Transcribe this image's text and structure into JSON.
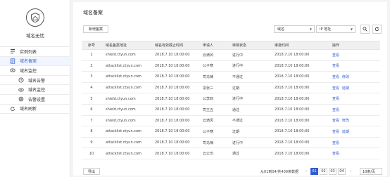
{
  "brand": {
    "name": "域名无忧"
  },
  "sidebar": {
    "items": [
      {
        "label": "实例列表"
      },
      {
        "label": "域名备案"
      },
      {
        "label": "域名监控"
      },
      {
        "label": "域名告警"
      },
      {
        "label": "域名监控"
      },
      {
        "label": "告警设置"
      },
      {
        "label": "域名刷新"
      }
    ]
  },
  "page": {
    "title": "域名备案"
  },
  "toolbar": {
    "add_label": "新增备案",
    "field_select": "域名",
    "ip_select": "IP 地址"
  },
  "table": {
    "headers": [
      "序号",
      "域名备案地址",
      "域名有效截止时间",
      "申请人",
      "审核状态",
      "审批时间",
      "操作"
    ],
    "rows": [
      {
        "no": "1",
        "domain": "shield.ctyun.com",
        "expire": "2018.7.10 18:00:00",
        "applicant": "云滴风",
        "status": "进行中",
        "approved": "2018.7.10 18:00:00",
        "ops": [
          "查看"
        ]
      },
      {
        "no": "2",
        "domain": "attacklist.ctyun.com",
        "expire": "2018.7.10 18:00:00",
        "applicant": "公子寒",
        "status": "进行中",
        "approved": "2018.7.10 18:00:00",
        "ops": [
          "查看"
        ]
      },
      {
        "no": "3",
        "domain": "attacklist.ctyun.com",
        "expire": "2018.7.10 18:00:00",
        "applicant": "司马楠",
        "status": "不通过",
        "approved": "2018.7.10 18:00:00",
        "ops": [
          "查看",
          "修改"
        ]
      },
      {
        "no": "4",
        "domain": "attacklist.ctyun.com",
        "expire": "2018.7.10 18:00:00",
        "applicant": "宗张三",
        "status": "过期",
        "approved": "2018.7.10 18:00:00",
        "ops": [
          "查看",
          "延期"
        ]
      },
      {
        "no": "5",
        "domain": "shield.ctyun.com",
        "expire": "2018.7.10 18:00:00",
        "applicant": "公李四",
        "status": "进行中",
        "approved": "2018.7.10 18:00:00",
        "ops": [
          "查看"
        ]
      },
      {
        "no": "6",
        "domain": "shield.ctyun.com",
        "expire": "2018.7.10 18:00:00",
        "applicant": "司王五",
        "status": "通过",
        "approved": "2018.7.10 18:00:00",
        "ops": [
          "查看"
        ]
      },
      {
        "no": "7",
        "domain": "shield.ctyun.com",
        "expire": "2018.7.10 18:00:00",
        "applicant": "云滴风",
        "status": "不通过",
        "approved": "2018.7.10 18:00:00",
        "ops": [
          "查看",
          "修改"
        ]
      },
      {
        "no": "8",
        "domain": "attacklist.ctyun.com",
        "expire": "2018.7.10 18:00:00",
        "applicant": "公子寒",
        "status": "过期",
        "approved": "2018.7.10 18:00:00",
        "ops": [
          "查看",
          "延期"
        ]
      },
      {
        "no": "9",
        "domain": "attacklist.ctyun.com",
        "expire": "2018.7.10 18:00:00",
        "applicant": "司马楠",
        "status": "进行中",
        "approved": "2018.7.10 18:00:00",
        "ops": [
          "查看"
        ]
      },
      {
        "no": "10",
        "domain": "attacklist.ctyun.com",
        "expire": "2018.7.10 18:00:00",
        "applicant": "云公司",
        "status": "通过",
        "approved": "2018.7.10 18:00:00",
        "ops": [
          "查看"
        ]
      }
    ]
  },
  "footer": {
    "export_label": "导出",
    "total_text": "从01到04/共400条数据",
    "pages": [
      "01",
      "02",
      "03",
      "04"
    ],
    "current_page": "01",
    "prev": "‹",
    "next": "›",
    "page_size": "10条/页"
  },
  "colors": {
    "accent": "#2f5bd3",
    "active_bg": "#f1f5ff"
  },
  "icons": {
    "logo": "shield-house-icon",
    "list": "list-icon",
    "record": "document-icon",
    "monitor": "eye-icon",
    "alert": "clock-icon",
    "settings": "gear-icon",
    "refresh": "refresh-icon",
    "search": "search-icon"
  }
}
